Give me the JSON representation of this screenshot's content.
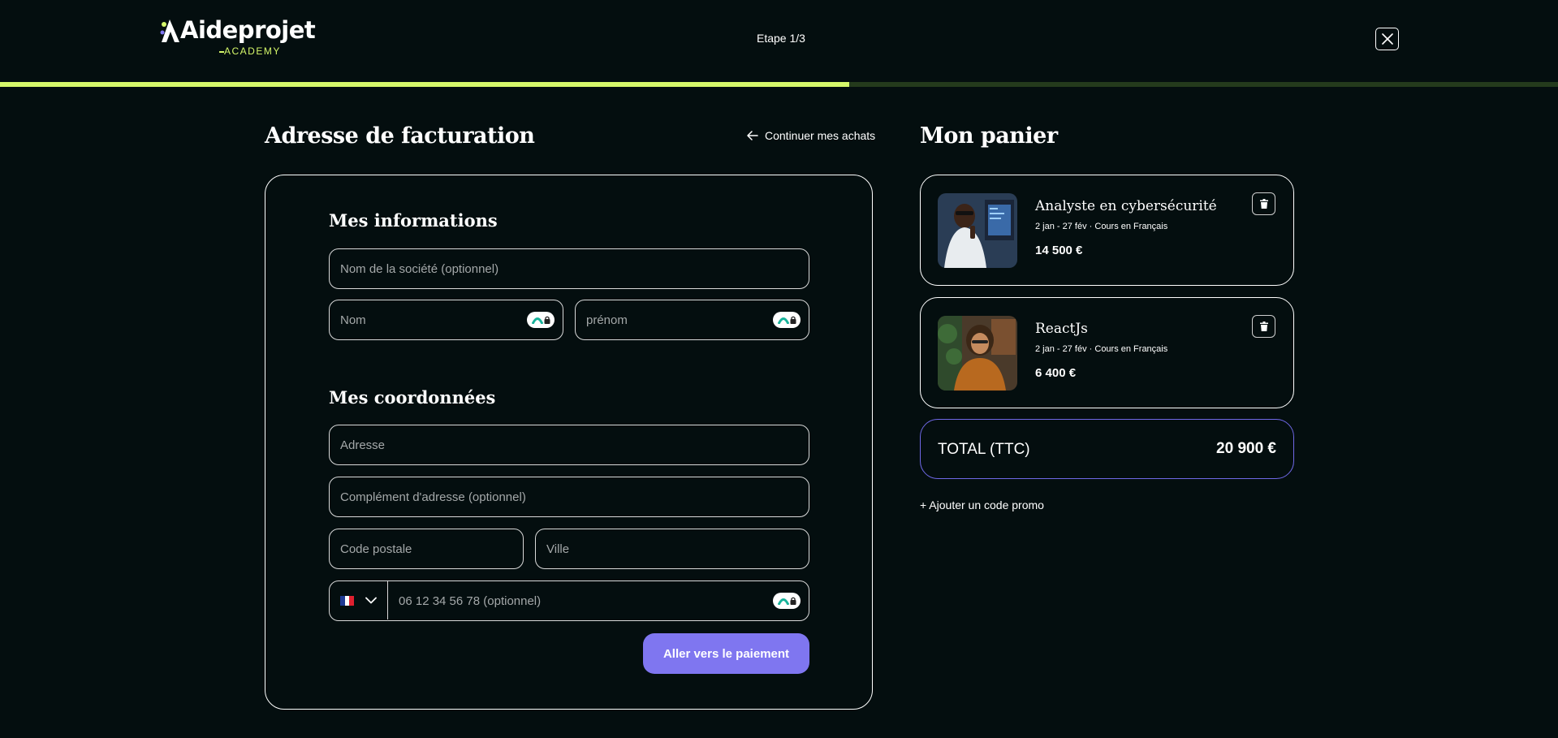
{
  "header": {
    "logo_text": "Aideprojet",
    "logo_sub": "ACADEMY",
    "step_label": "Etape 1/3",
    "progress_fraction": 0.545,
    "close_icon": "close-icon"
  },
  "billing": {
    "title": "Adresse de facturation",
    "continue_label": "Continuer mes achats",
    "section_info": "Mes informations",
    "section_contact": "Mes coordonnées",
    "fields": {
      "company": "Nom de la société (optionnel)",
      "last_name": "Nom",
      "first_name": "prénom",
      "address": "Adresse",
      "address2": "Complément d'adresse (optionnel)",
      "postal_code": "Code postale",
      "city": "Ville",
      "phone": "06 12 34 56 78 (optionnel)"
    },
    "phone_country": "FR",
    "submit_label": "Aller vers le paiement"
  },
  "cart": {
    "title": "Mon panier",
    "items": [
      {
        "title": "Analyste en cybersécurité",
        "subtitle": "2 jan - 27 fév · Cours en Français",
        "price": "14 500 €"
      },
      {
        "title": "ReactJs",
        "subtitle": "2 jan - 27 fév · Cours en Français",
        "price": "6 400 €"
      }
    ],
    "total_label": "TOTAL (TTC)",
    "total_value": "20 900 €",
    "promo_label": "+ Ajouter un code promo"
  },
  "colors": {
    "background": "#040e0f",
    "accent_lime": "#d5f76a",
    "accent_purple": "#7f76f0"
  }
}
